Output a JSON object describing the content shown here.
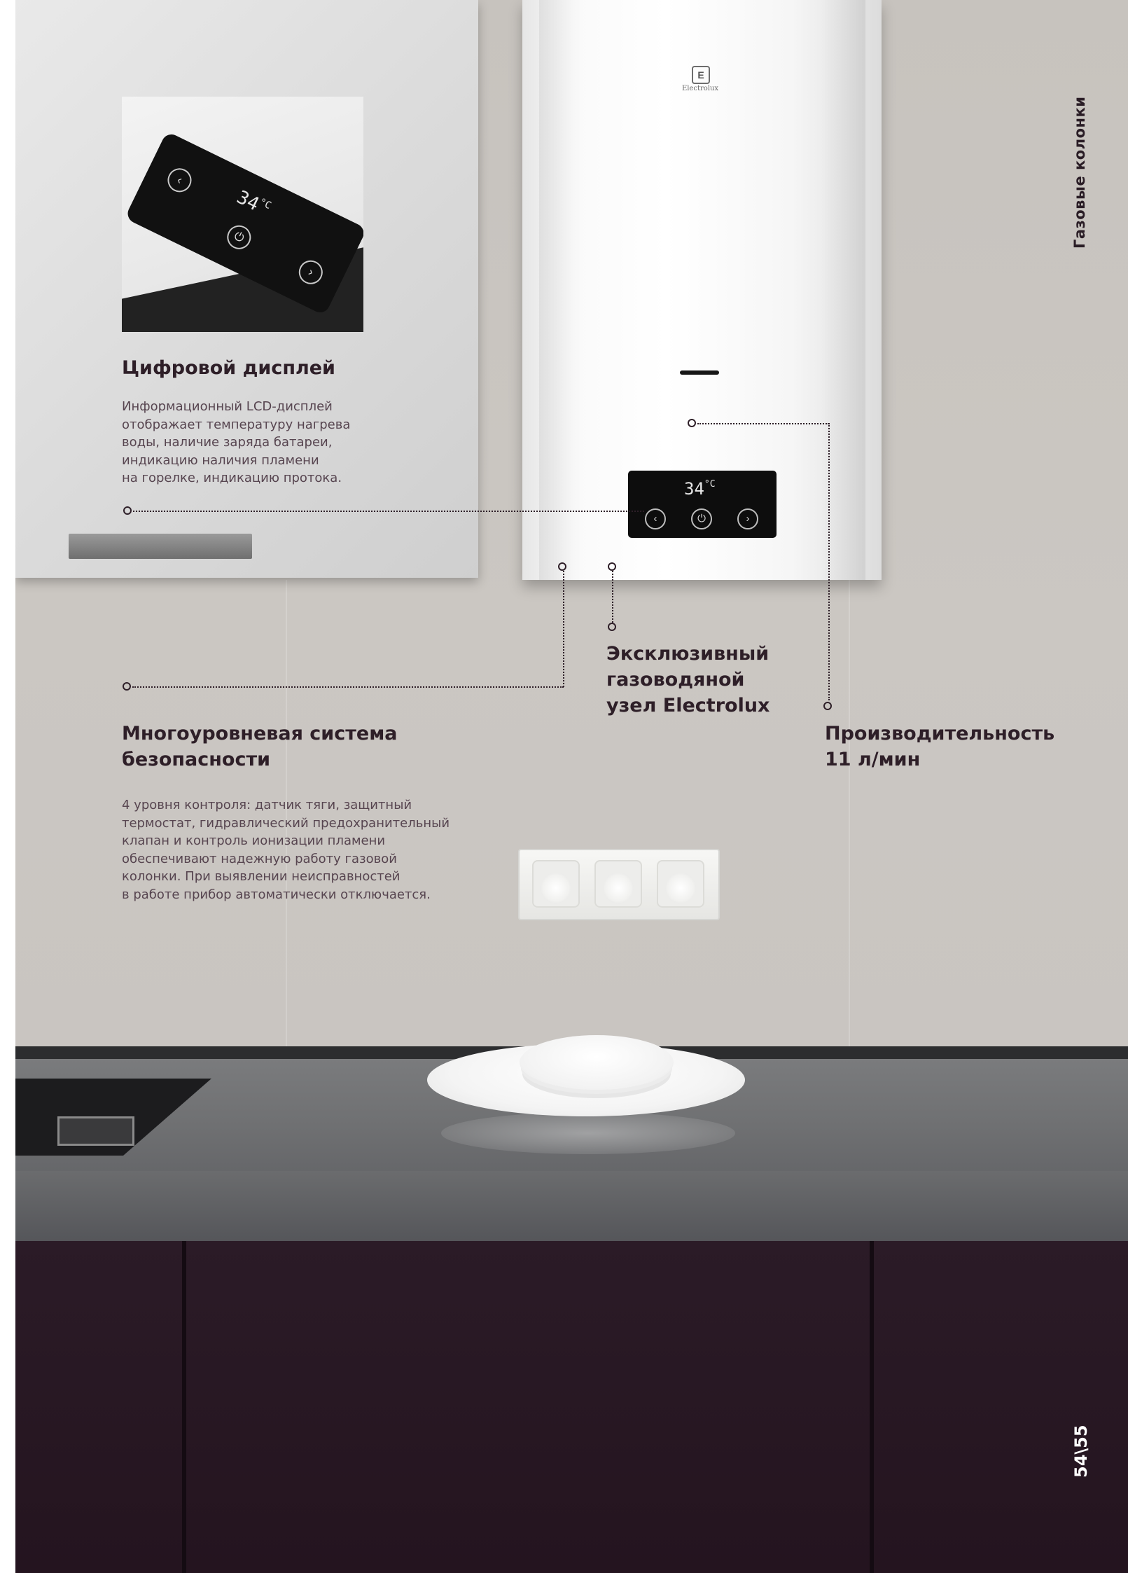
{
  "section_title": "Газовые колонки",
  "page_number": "54\\55",
  "brand": {
    "logo_text": "Electrolux",
    "logo_mark": "E"
  },
  "device_display": {
    "temperature": "34",
    "unit": "°C"
  },
  "features": [
    {
      "title": "Цифровой дисплей",
      "text": "Информационный LCD-дисплей\nотображает температуру нагрева\nводы, наличие заряда батареи,\nиндикацию наличия пламени\nна горелке, индикацию протока."
    },
    {
      "title": "Многоуровневая система\nбезопасности",
      "text": "4 уровня контроля: датчик тяги, защитный\nтермостат, гидравлический предохранительный\nклапан и контроль ионизации пламени\nобеспечивают надежную работу газовой\nколонки. При выявлении неисправностей\nв работе прибор автоматически отключается."
    },
    {
      "title": "Эксклюзивный\nгазоводяной\nузел Electrolux"
    },
    {
      "title": "Производительность\n11 л/мин"
    }
  ],
  "icons": [
    "electrolux-logo-icon",
    "left-arrow-icon",
    "power-icon",
    "right-arrow-icon"
  ],
  "colors": {
    "heading": "#2e1f28",
    "body_text": "#574550",
    "cabinet_lower": "#24141f"
  }
}
